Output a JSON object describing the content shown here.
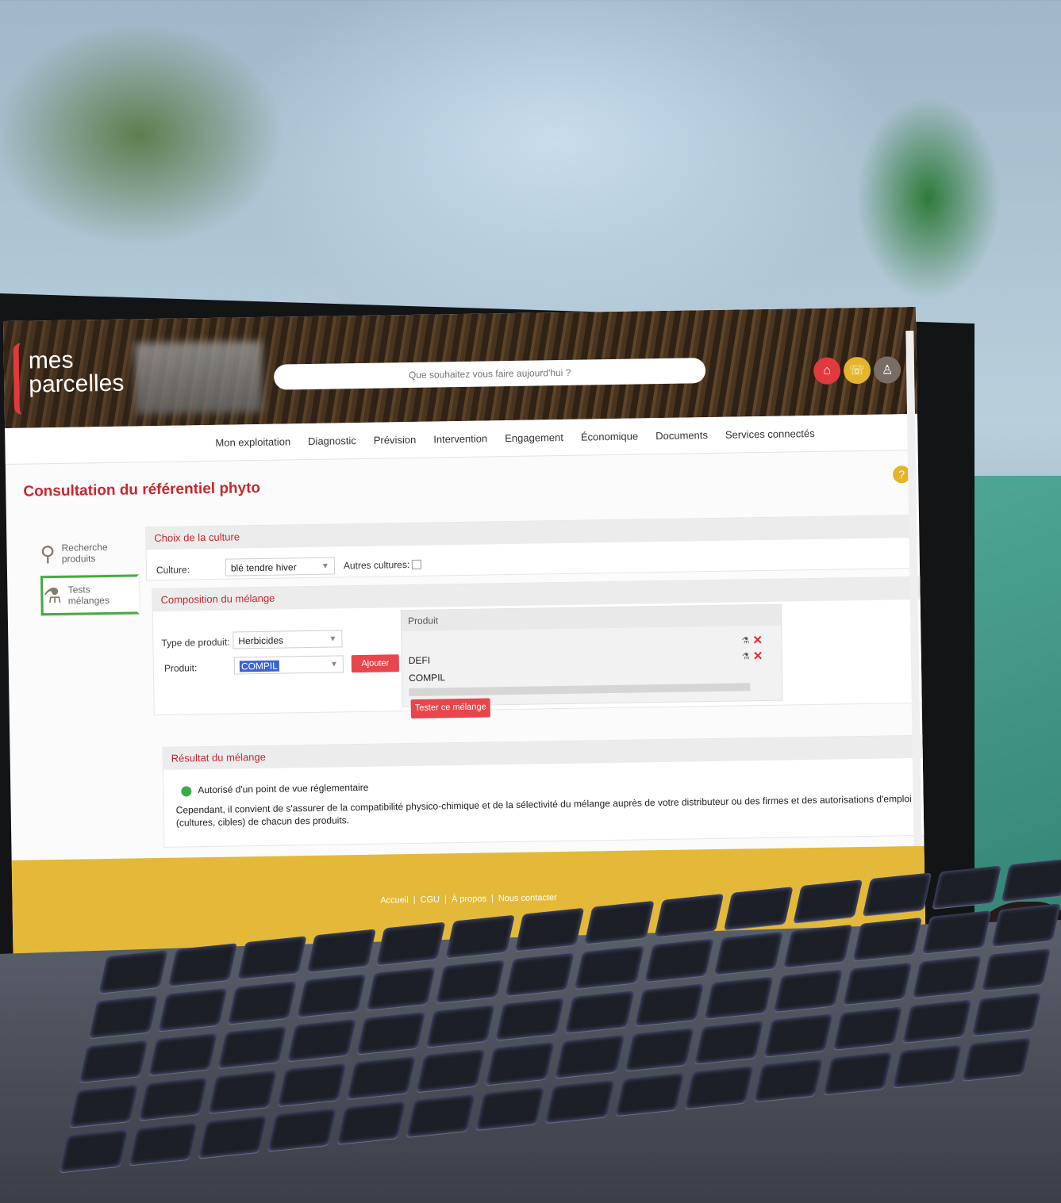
{
  "header": {
    "logo_line1": "mes",
    "logo_line2": "parcelles",
    "search_placeholder": "Que souhaitez vous faire aujourd'hui ?",
    "buttons": [
      {
        "icon": "home-icon",
        "color": "#e03a3e"
      },
      {
        "icon": "chat-icon",
        "color": "#e3b42c"
      },
      {
        "icon": "user-icon",
        "color": "#7a6d66"
      }
    ]
  },
  "nav": [
    "Mon exploitation",
    "Diagnostic",
    "Prévision",
    "Intervention",
    "Engagement",
    "Économique",
    "Documents",
    "Services connectés"
  ],
  "page_title": "Consultation du référentiel phyto",
  "help_icon": "?",
  "sidebar": [
    {
      "label_line1": "Recherche",
      "label_line2": "produits",
      "icon": "search-products-icon"
    },
    {
      "label_line1": "Tests",
      "label_line2": "mélanges",
      "icon": "flask-test-icon"
    }
  ],
  "culture_panel": {
    "title": "Choix de la culture",
    "culture_label": "Culture:",
    "culture_value": "blé tendre hiver",
    "other_label": "Autres cultures:"
  },
  "mix_panel": {
    "title": "Composition du mélange",
    "type_label": "Type de produit:",
    "type_value": "Herbicides",
    "product_label": "Produit:",
    "product_value": "COMPIL",
    "add_button": "Ajouter",
    "list_header": "Produit",
    "products": [
      "DEFI",
      "COMPIL"
    ],
    "test_button": "Tester ce mélange"
  },
  "result_panel": {
    "title": "Résultat du mélange",
    "status": "Autorisé d'un point de vue réglementaire",
    "status_color": "#3daa4a",
    "note": "Cependant, il convient de s'assurer de la compatibilité physico-chimique et de la sélectivité du mélange auprès de votre distributeur ou des firmes et des autorisations d'emploi (cultures, cibles) de chacun des produits."
  },
  "footer": [
    "Accueil",
    "CGU",
    "À propos",
    "Nous contacter"
  ]
}
